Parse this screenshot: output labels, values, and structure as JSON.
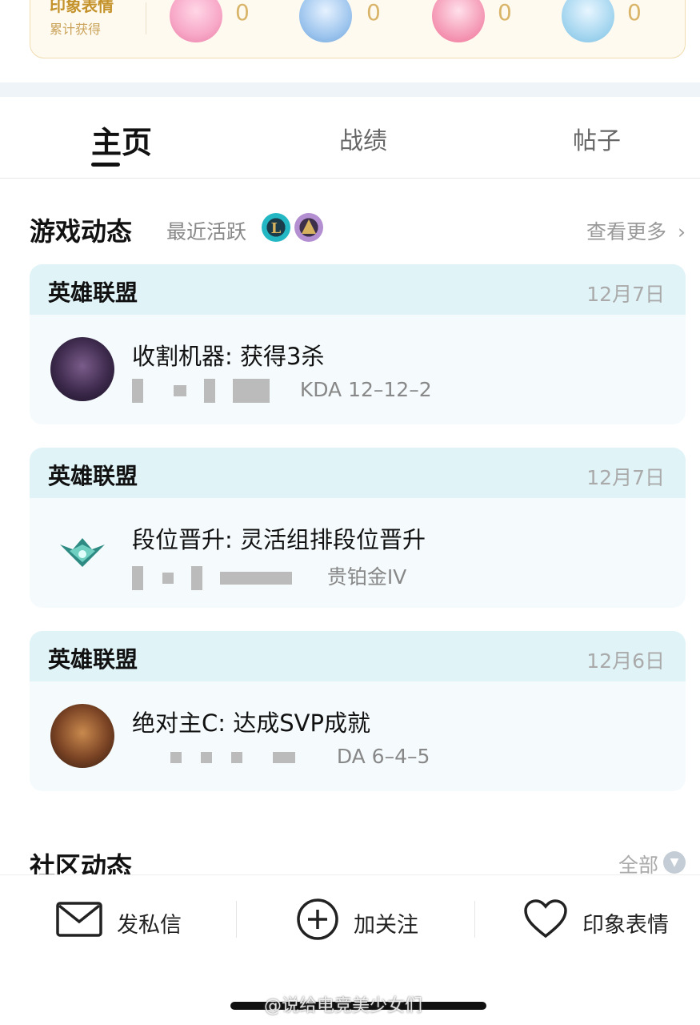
{
  "impression": {
    "title": "印象表情",
    "subtitle": "累计获得",
    "emojis": [
      {
        "icon": "emoji-avatar-1-icon",
        "count": "0"
      },
      {
        "icon": "emoji-avatar-2-icon",
        "count": "0"
      },
      {
        "icon": "emoji-avatar-3-icon",
        "count": "0"
      },
      {
        "icon": "emoji-avatar-4-icon",
        "count": "0"
      }
    ]
  },
  "tabs": [
    {
      "label": "主页",
      "active": true
    },
    {
      "label": "战绩",
      "active": false
    },
    {
      "label": "帖子",
      "active": false
    }
  ],
  "game_feed": {
    "title": "游戏动态",
    "recent": "最近活跃",
    "game_icons": [
      "lol-icon",
      "tft-icon"
    ],
    "more": "查看更多",
    "items": [
      {
        "game": "英雄联盟",
        "date": "12月7日",
        "title": "收割机器: 获得3杀",
        "detail": "KDA 12–12–2",
        "avatar": "kaisa-avatar"
      },
      {
        "game": "英雄联盟",
        "date": "12月7日",
        "title": "段位晋升: 灵活组排段位晋升",
        "detail": "贵铂金IV",
        "avatar": "rank-emblem-icon"
      },
      {
        "game": "英雄联盟",
        "date": "12月6日",
        "title": "绝对主C: 达成SVP成就",
        "detail": "DA 6–4–5",
        "avatar": "sivir-avatar"
      }
    ]
  },
  "community": {
    "title": "社区动态",
    "all": "全部"
  },
  "actions": {
    "message": "发私信",
    "follow": "加关注",
    "impression": "印象表情"
  },
  "watermark": "@说给电竞美少女们",
  "colors": {
    "accent_tint": "#e0f3f7",
    "card_bg": "#f5fbfd",
    "gold": "#c4922a"
  }
}
